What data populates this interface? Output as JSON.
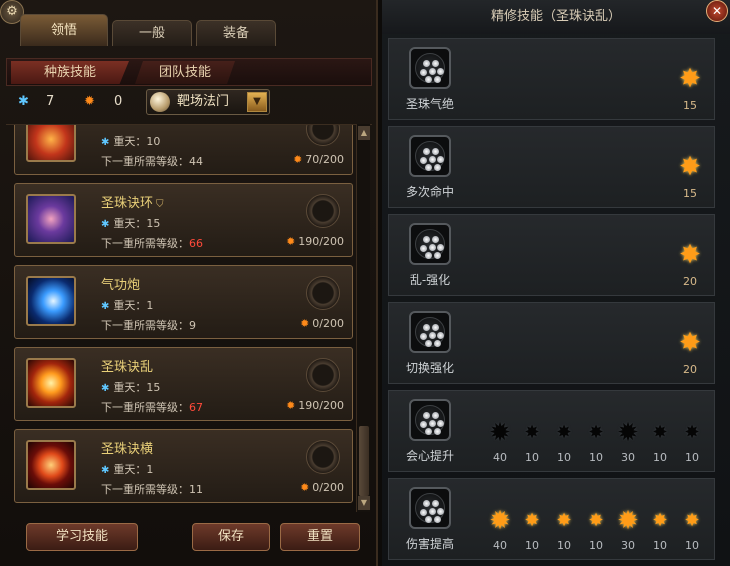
{
  "left": {
    "tabs": [
      "领悟",
      "一般",
      "装备"
    ],
    "subtabs": [
      "种族技能",
      "团队技能"
    ],
    "resources": {
      "crystal": "7",
      "sun": "0"
    },
    "book": {
      "label": "靶场法门"
    },
    "skills": [
      {
        "name": "",
        "heaven": "重天：10",
        "req_label": "下一重所需等级：",
        "req_value": "44",
        "req_red": false,
        "exp": "70/200"
      },
      {
        "name": "圣珠诀环",
        "heaven": "重天：15",
        "req_label": "下一重所需等级：",
        "req_value": "66",
        "req_red": true,
        "exp": "190/200"
      },
      {
        "name": "气功炮",
        "heaven": "重天：1",
        "req_label": "下一重所需等级：",
        "req_value": "9",
        "req_red": false,
        "exp": "0/200"
      },
      {
        "name": "圣珠诀乱",
        "heaven": "重天：15",
        "req_label": "下一重所需等级：",
        "req_value": "67",
        "req_red": true,
        "exp": "190/200"
      },
      {
        "name": "圣珠诀横",
        "heaven": "重天：1",
        "req_label": "下一重所需等级：",
        "req_value": "11",
        "req_red": false,
        "exp": "0/200"
      }
    ],
    "buttons": {
      "learn": "学习技能",
      "save": "保存",
      "reset": "重置"
    }
  },
  "right": {
    "title": "精修技能（圣珠诀乱）",
    "rows": [
      {
        "label": "圣珠气绝",
        "stars": [
          {
            "lit": true,
            "level": "15"
          }
        ]
      },
      {
        "label": "多次命中",
        "stars": [
          {
            "lit": true,
            "level": "15"
          }
        ]
      },
      {
        "label": "乱-强化",
        "stars": [
          {
            "lit": true,
            "level": "20"
          }
        ]
      },
      {
        "label": "切换强化",
        "stars": [
          {
            "lit": true,
            "level": "20"
          }
        ]
      },
      {
        "label": "会心提升",
        "stars": [
          {
            "lit": false,
            "level": "40",
            "big": true
          },
          {
            "lit": false,
            "level": "10"
          },
          {
            "lit": false,
            "level": "10"
          },
          {
            "lit": false,
            "level": "10"
          },
          {
            "lit": false,
            "level": "30",
            "big": true
          },
          {
            "lit": false,
            "level": "10"
          },
          {
            "lit": false,
            "level": "10"
          }
        ]
      },
      {
        "label": "伤害提高",
        "stars": [
          {
            "lit": true,
            "level": "40",
            "big": true
          },
          {
            "lit": true,
            "level": "10"
          },
          {
            "lit": true,
            "level": "10"
          },
          {
            "lit": true,
            "level": "10"
          },
          {
            "lit": true,
            "level": "30",
            "big": true
          },
          {
            "lit": true,
            "level": "10"
          },
          {
            "lit": true,
            "level": "10"
          }
        ]
      }
    ]
  },
  "colors": {
    "accent_gold": "#e8cf78",
    "red_value": "#ff4a3a",
    "star_lit": "#ff9c18"
  },
  "icons": [
    "gear-icon",
    "close-icon",
    "crystal-icon",
    "sun-icon",
    "dropdown-arrow-icon",
    "shield-icon",
    "star-icon",
    "orb-icon"
  ]
}
